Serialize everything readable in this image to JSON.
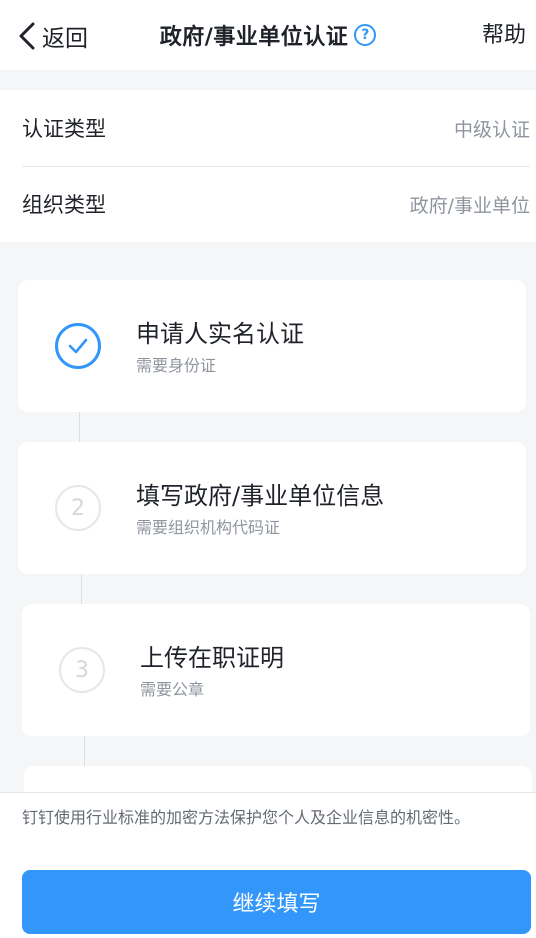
{
  "nav": {
    "back_label": "返回",
    "title": "政府/事业单位认证",
    "help_label": "帮助"
  },
  "info": {
    "rows": [
      {
        "label": "认证类型",
        "value": "中级认证"
      },
      {
        "label": "组织类型",
        "value": "政府/事业单位"
      }
    ]
  },
  "steps": [
    {
      "number": "",
      "title": "申请人实名认证",
      "subtitle": "需要身份证",
      "status": "done"
    },
    {
      "number": "2",
      "title": "填写政府/事业单位信息",
      "subtitle": "需要组织机构代码证",
      "status": "todo"
    },
    {
      "number": "3",
      "title": "上传在职证明",
      "subtitle": "需要公章",
      "status": "todo"
    }
  ],
  "footer": {
    "notice": "钉钉使用行业标准的加密方法保护您个人及企业信息的机密性。",
    "continue_label": "继续填写"
  },
  "colors": {
    "accent": "#3296fa",
    "background": "#f5f6f7",
    "text_primary": "#1f2329",
    "text_secondary": "#8f959e"
  }
}
